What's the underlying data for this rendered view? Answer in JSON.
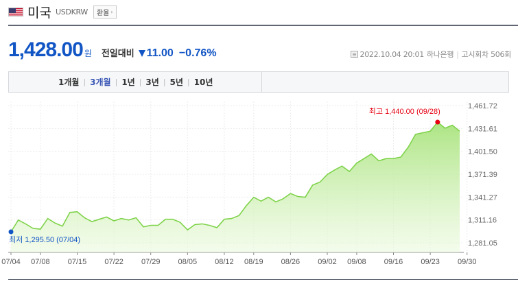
{
  "header": {
    "country": "미국",
    "code": "USDKRW",
    "rate_button": "환율"
  },
  "quote": {
    "price": "1,428.00",
    "unit": "원",
    "compare_label": "전일대비",
    "change": "11.00",
    "change_pct": "−0.76%",
    "direction": "down",
    "color_down": "#1255c5"
  },
  "meta": {
    "datetime": "2022.10.04 20:01",
    "bank": "하나은행",
    "notice": "고시회차 506회"
  },
  "periods": [
    {
      "label": "1개월",
      "active": false
    },
    {
      "label": "3개월",
      "active": true
    },
    {
      "label": "1년",
      "active": false
    },
    {
      "label": "3년",
      "active": false
    },
    {
      "label": "5년",
      "active": false
    },
    {
      "label": "10년",
      "active": false
    }
  ],
  "chart_data": {
    "type": "area",
    "line_color": "#7fd34b",
    "fill_color": "#a8e37c",
    "ylim": [
      1281.05,
      1461.72
    ],
    "y_ticks": [
      "1,461.72",
      "1,431.61",
      "1,401.50",
      "1,371.39",
      "1,341.27",
      "1,311.16",
      "1,281.05"
    ],
    "x_ticks": [
      "07/04",
      "07/08",
      "07/15",
      "07/22",
      "07/29",
      "08/05",
      "08/12",
      "08/19",
      "08/26",
      "09/02",
      "09/08",
      "09/16",
      "09/23",
      "09/30"
    ],
    "x_tick_index": [
      0,
      4,
      9,
      14,
      19,
      24,
      29,
      33,
      38,
      43,
      47,
      52,
      57,
      62
    ],
    "values": [
      1295.5,
      1311,
      1306,
      1300,
      1299,
      1313,
      1307,
      1303,
      1321,
      1322,
      1314,
      1309,
      1312,
      1315,
      1310,
      1313,
      1311,
      1314,
      1302,
      1304,
      1304,
      1312,
      1312,
      1308,
      1298,
      1305,
      1306,
      1304,
      1301,
      1312,
      1313,
      1317,
      1330,
      1341,
      1336,
      1341,
      1335,
      1339,
      1346,
      1342,
      1341,
      1357,
      1361,
      1371,
      1377,
      1382,
      1375,
      1386,
      1392,
      1398,
      1389,
      1392,
      1392,
      1394,
      1407,
      1424,
      1426,
      1428,
      1440,
      1432,
      1436,
      1428
    ],
    "high": {
      "label": "최고 1,440.00 (09/28)",
      "index": 58,
      "value": 1440.0,
      "color": "#e60012"
    },
    "low": {
      "label": "최저 1,295.50 (07/04)",
      "index": 0,
      "value": 1295.5,
      "color": "#1255c5"
    },
    "grid": true
  }
}
